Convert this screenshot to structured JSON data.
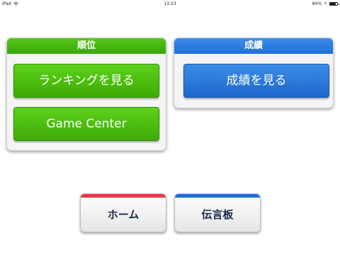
{
  "statusbar": {
    "device": "iPad",
    "time": "13:23",
    "battery": "84%"
  },
  "ranking_panel": {
    "title": "順位",
    "view_ranking_label": "ランキングを見る",
    "game_center_label": "Game Center"
  },
  "score_panel": {
    "title": "成績",
    "view_score_label": "成績を見る"
  },
  "bottom": {
    "home_label": "ホーム",
    "board_label": "伝言板"
  },
  "colors": {
    "green": "#3eaa06",
    "blue": "#1f6fd6",
    "home_accent": "#e8384a",
    "board_accent": "#1f6fd6"
  }
}
